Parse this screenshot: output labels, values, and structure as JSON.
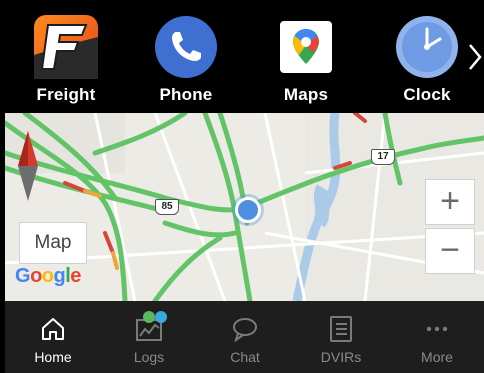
{
  "launcher": {
    "apps": [
      {
        "label": "Freight",
        "icon": "freight-app-icon"
      },
      {
        "label": "Phone",
        "icon": "phone-app-icon"
      },
      {
        "label": "Maps",
        "icon": "maps-app-icon"
      },
      {
        "label": "Clock",
        "icon": "clock-app-icon"
      }
    ],
    "more_icon": "chevron-right-icon"
  },
  "map": {
    "map_type_label": "Map",
    "google_logo": "Google",
    "zoom_in_label": "+",
    "zoom_out_label": "−",
    "road_shields": [
      "85",
      "17"
    ]
  },
  "bottom_nav": {
    "items": [
      {
        "label": "Home",
        "icon": "home-icon",
        "active": true
      },
      {
        "label": "Logs",
        "icon": "logs-chart-icon",
        "active": false
      },
      {
        "label": "Chat",
        "icon": "chat-bubble-icon",
        "active": false
      },
      {
        "label": "DVIRs",
        "icon": "dvir-list-icon",
        "active": false
      },
      {
        "label": "More",
        "icon": "more-dots-icon",
        "active": false
      }
    ],
    "badge_colors": [
      "#5cb85c",
      "#39a7e0"
    ]
  },
  "colors": {
    "traffic_green": "#63c467",
    "traffic_red": "#d6453a",
    "water_blue": "#a9cbe8"
  }
}
